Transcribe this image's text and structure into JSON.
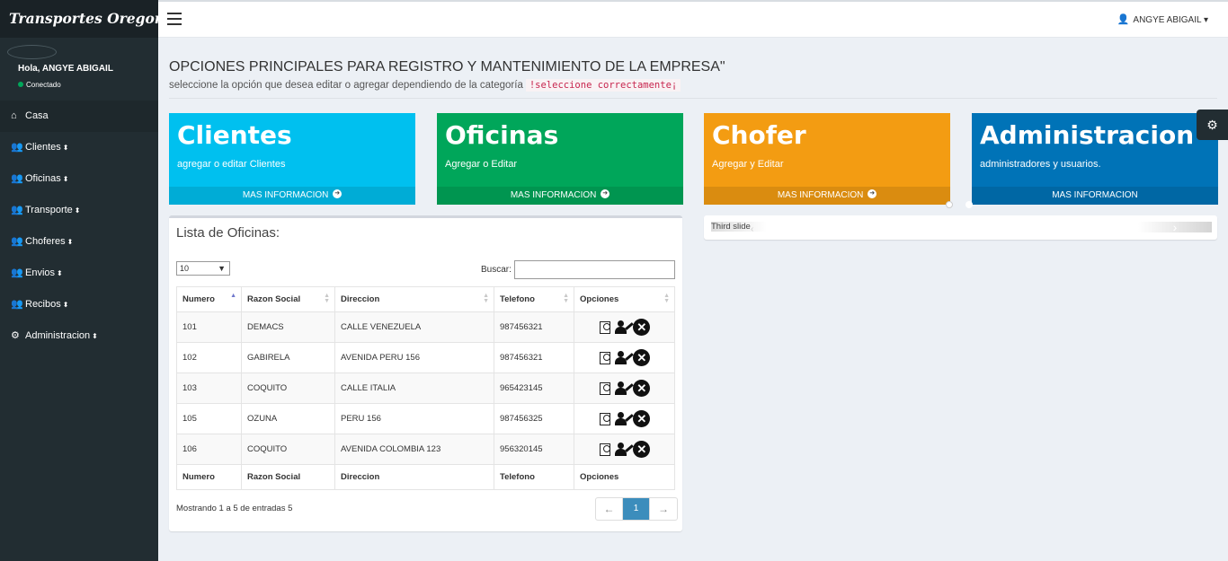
{
  "app": {
    "brand": "Transportes Oregon S.A."
  },
  "header": {
    "user_name": "ANGYE ABIGAIL",
    "user_caret": "▾"
  },
  "user_panel": {
    "greeting": "Hola, ANGYE ABIGAIL",
    "status": "Conectado",
    "status_color": "#00a65a"
  },
  "sidebar": {
    "items": [
      {
        "label": "Casa",
        "icon": "home-icon"
      },
      {
        "label": "Clientes",
        "icon": "users-icon"
      },
      {
        "label": "Oficinas",
        "icon": "users-icon"
      },
      {
        "label": "Transporte",
        "icon": "users-icon"
      },
      {
        "label": "Choferes",
        "icon": "users-icon"
      },
      {
        "label": "Envios",
        "icon": "users-icon"
      },
      {
        "label": "Recibos",
        "icon": "users-icon"
      },
      {
        "label": "Administracion",
        "icon": "cogs-icon"
      }
    ]
  },
  "main": {
    "title": "OPCIONES PRINCIPALES PARA REGISTRO Y MANTENIMIENTO DE LA EMPRESA\"",
    "subtitle": "seleccione la opción que desea editar o agregar dependiendo de la categoría",
    "subtitle_code": "!seleccione correctamente¡"
  },
  "boxes": [
    {
      "title": "Clientes",
      "text": "agregar o editar Clientes",
      "footer": "MAS INFORMACION",
      "color": "#00c0ef"
    },
    {
      "title": "Oficinas",
      "text": "Agregar o Editar",
      "footer": "MAS INFORMACION",
      "color": "#00a65a"
    },
    {
      "title": "Chofer",
      "text": "Agregar y Editar",
      "footer": "MAS INFORMACION",
      "color": "#f39c12"
    },
    {
      "title": "Administracion",
      "text": "administradores y usuarios.",
      "footer": "MAS INFORMACION",
      "color": "#0073b7"
    }
  ],
  "table_box": {
    "title": "Lista de Oficinas:",
    "length_value": "10",
    "search_label": "Buscar:",
    "search_value": "",
    "columns": [
      "Numero",
      "Razon Social",
      "Direccion",
      "Telefono",
      "Opciones"
    ],
    "rows": [
      [
        "101",
        "DEMACS",
        "CALLE VENEZUELA",
        "987456321"
      ],
      [
        "102",
        "GABIRELA",
        "AVENIDA PERU 156",
        "987456321"
      ],
      [
        "103",
        "COQUITO",
        "CALLE ITALIA",
        "965423145"
      ],
      [
        "105",
        "OZUNA",
        "PERU 156",
        "987456325"
      ],
      [
        "106",
        "COQUITO",
        "AVENIDA COLOMBIA 123",
        "956320145"
      ]
    ],
    "info": "Mostrando 1 a 5 de entradas 5",
    "pagination": {
      "prev": "←",
      "current": "1",
      "next": "→"
    }
  },
  "carousel": {
    "caption": "Third slide"
  }
}
